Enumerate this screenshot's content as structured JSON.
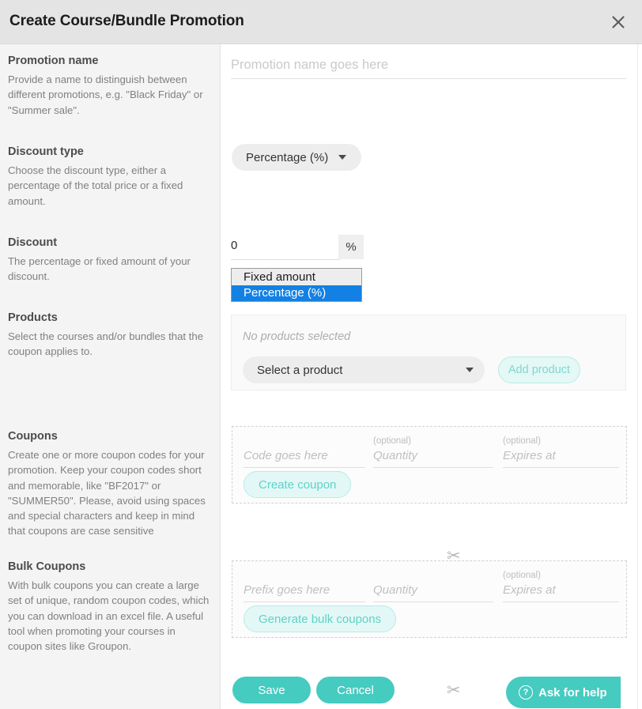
{
  "header": {
    "title": "Create Course/Bundle Promotion",
    "close_icon": "close-icon"
  },
  "sidebar": {
    "sections": [
      {
        "heading": "Promotion name",
        "body": "Provide a name to distinguish between different promotions, e.g. \"Black Friday\" or \"Summer sale\"."
      },
      {
        "heading": "Discount type",
        "body": "Choose the discount type, either a percentage of the total price or a fixed amount."
      },
      {
        "heading": "Discount",
        "body": "The percentage or fixed amount of your discount."
      },
      {
        "heading": "Products",
        "body": "Select the courses and/or bundles that the coupon applies to."
      },
      {
        "heading": "Coupons",
        "body": "Create one or more coupon codes for your promotion. Keep your coupon codes short and memorable, like \"BF2017\" or \"SUMMER50\". Please, avoid using spaces and special characters and keep in mind that coupons are case sensitive"
      },
      {
        "heading": "Bulk Coupons",
        "body": "With bulk coupons you can create a large set of unique, random coupon codes, which you can download in an excel file. A useful tool when promoting your courses in coupon sites like Groupon."
      }
    ]
  },
  "main": {
    "promotion_name": {
      "value": "",
      "placeholder": "Promotion name goes here"
    },
    "discount_type": {
      "selected": "Percentage (%)",
      "options": [
        "Fixed amount",
        "Percentage (%)"
      ],
      "caret_icon": "chevron-down-icon"
    },
    "discount": {
      "value": "0",
      "unit": "%"
    },
    "dropdown_open": {
      "options": [
        {
          "label": "Fixed amount",
          "selected": false
        },
        {
          "label": "Percentage (%)",
          "selected": true
        }
      ]
    },
    "products": {
      "empty_text": "No products selected",
      "select_placeholder": "Select a product",
      "add_button": "Add product",
      "caret_icon": "chevron-down-icon"
    },
    "coupons": {
      "code_placeholder": "Code goes here",
      "quantity_placeholder": "Quantity",
      "quantity_optional": "(optional)",
      "expires_placeholder": "Expires at",
      "expires_optional": "(optional)",
      "create_button": "Create coupon",
      "scissors_icon": "scissors-icon"
    },
    "bulk_coupons": {
      "prefix_placeholder": "Prefix goes here",
      "quantity_placeholder": "Quantity",
      "expires_placeholder": "Expires at",
      "expires_optional": "(optional)",
      "generate_button": "Generate bulk coupons",
      "scissors_icon": "scissors-icon"
    },
    "footer": {
      "save": "Save",
      "cancel": "Cancel",
      "help": "Ask for help",
      "help_icon": "question-mark-icon"
    }
  },
  "colors": {
    "teal": "#45cbc0",
    "teal_light": "#e3f8f6",
    "header_bg": "#e4e4e4",
    "sidebar_bg": "#f4f4f4",
    "highlight_blue": "#1381e3"
  }
}
